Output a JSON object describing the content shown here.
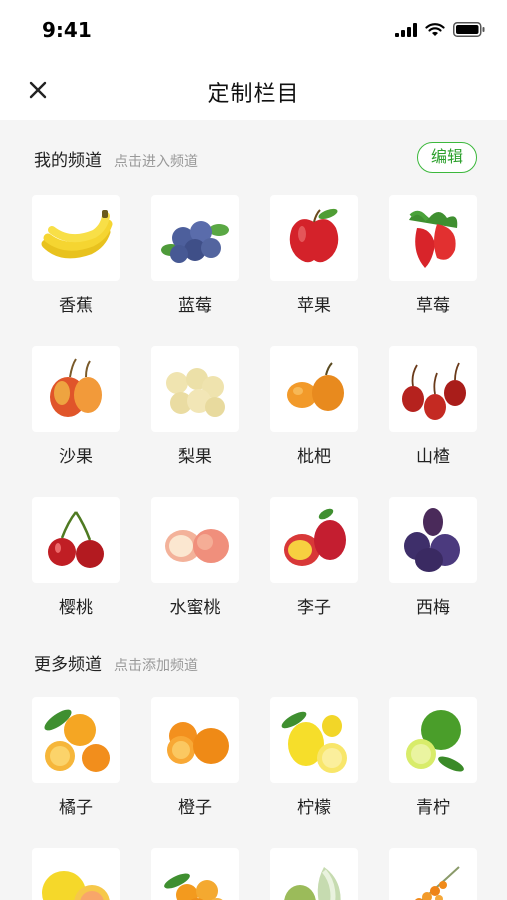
{
  "status": {
    "time": "9:41"
  },
  "nav": {
    "title": "定制栏目"
  },
  "my_channels": {
    "title": "我的频道",
    "hint": "点击进入频道",
    "edit_label": "编辑",
    "items": [
      {
        "label": "香蕉",
        "icon": "banana-icon"
      },
      {
        "label": "蓝莓",
        "icon": "blueberry-icon"
      },
      {
        "label": "苹果",
        "icon": "apple-icon"
      },
      {
        "label": "草莓",
        "icon": "strawberry-icon"
      },
      {
        "label": "沙果",
        "icon": "crabapple-icon"
      },
      {
        "label": "梨果",
        "icon": "pear-icon"
      },
      {
        "label": "枇杷",
        "icon": "loquat-icon"
      },
      {
        "label": "山楂",
        "icon": "hawthorn-icon"
      },
      {
        "label": "樱桃",
        "icon": "cherry-icon"
      },
      {
        "label": "水蜜桃",
        "icon": "peach-icon"
      },
      {
        "label": "李子",
        "icon": "plum-icon"
      },
      {
        "label": "西梅",
        "icon": "prune-icon"
      }
    ]
  },
  "more_channels": {
    "title": "更多频道",
    "hint": "点击添加频道",
    "items": [
      {
        "label": "橘子",
        "icon": "tangerine-icon"
      },
      {
        "label": "橙子",
        "icon": "orange-icon"
      },
      {
        "label": "柠檬",
        "icon": "lemon-icon"
      },
      {
        "label": "青柠",
        "icon": "lime-icon"
      },
      {
        "label": "",
        "icon": "grapefruit-icon"
      },
      {
        "label": "",
        "icon": "kumquat-icon"
      },
      {
        "label": "",
        "icon": "chayote-icon"
      },
      {
        "label": "",
        "icon": "sea-buckthorn-icon"
      }
    ]
  },
  "colors": {
    "accent": "#2ca02c",
    "background": "#f5f5f5"
  }
}
